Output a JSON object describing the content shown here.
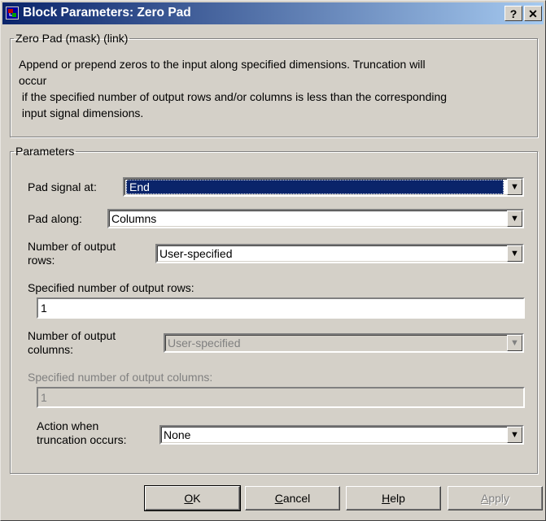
{
  "window": {
    "title": "Block Parameters: Zero Pad",
    "help_label": "?",
    "close_label": "✕"
  },
  "description": {
    "group_title": "Zero Pad (mask) (link)",
    "text_line1": "Append or prepend zeros to the input along specified dimensions.  Truncation will",
    "text_line2": "occur",
    "text_line3": " if the specified number of output rows and/or columns is less than the corresponding",
    "text_line4": " input signal dimensions."
  },
  "parameters": {
    "group_title": "Parameters",
    "pad_signal_at": {
      "label": "Pad signal at:",
      "value": "End"
    },
    "pad_along": {
      "label": "Pad along:",
      "value": "Columns"
    },
    "num_output_rows": {
      "label_line1": "Number of output",
      "label_line2": "rows:",
      "value": "User-specified"
    },
    "specified_rows": {
      "label": "Specified number of output rows:",
      "value": "1"
    },
    "num_output_cols": {
      "label_line1": "Number of output",
      "label_line2": "columns:",
      "value": "User-specified"
    },
    "specified_cols": {
      "label": "Specified number of output columns:",
      "value": "1"
    },
    "action_truncation": {
      "label_line1": "Action when",
      "label_line2": "truncation occurs:",
      "value": "None"
    }
  },
  "buttons": {
    "ok_key": "O",
    "ok_rest": "K",
    "cancel_key": "C",
    "cancel_rest": "ancel",
    "help_key": "H",
    "help_rest": "elp",
    "apply_key": "A",
    "apply_rest": "pply"
  }
}
